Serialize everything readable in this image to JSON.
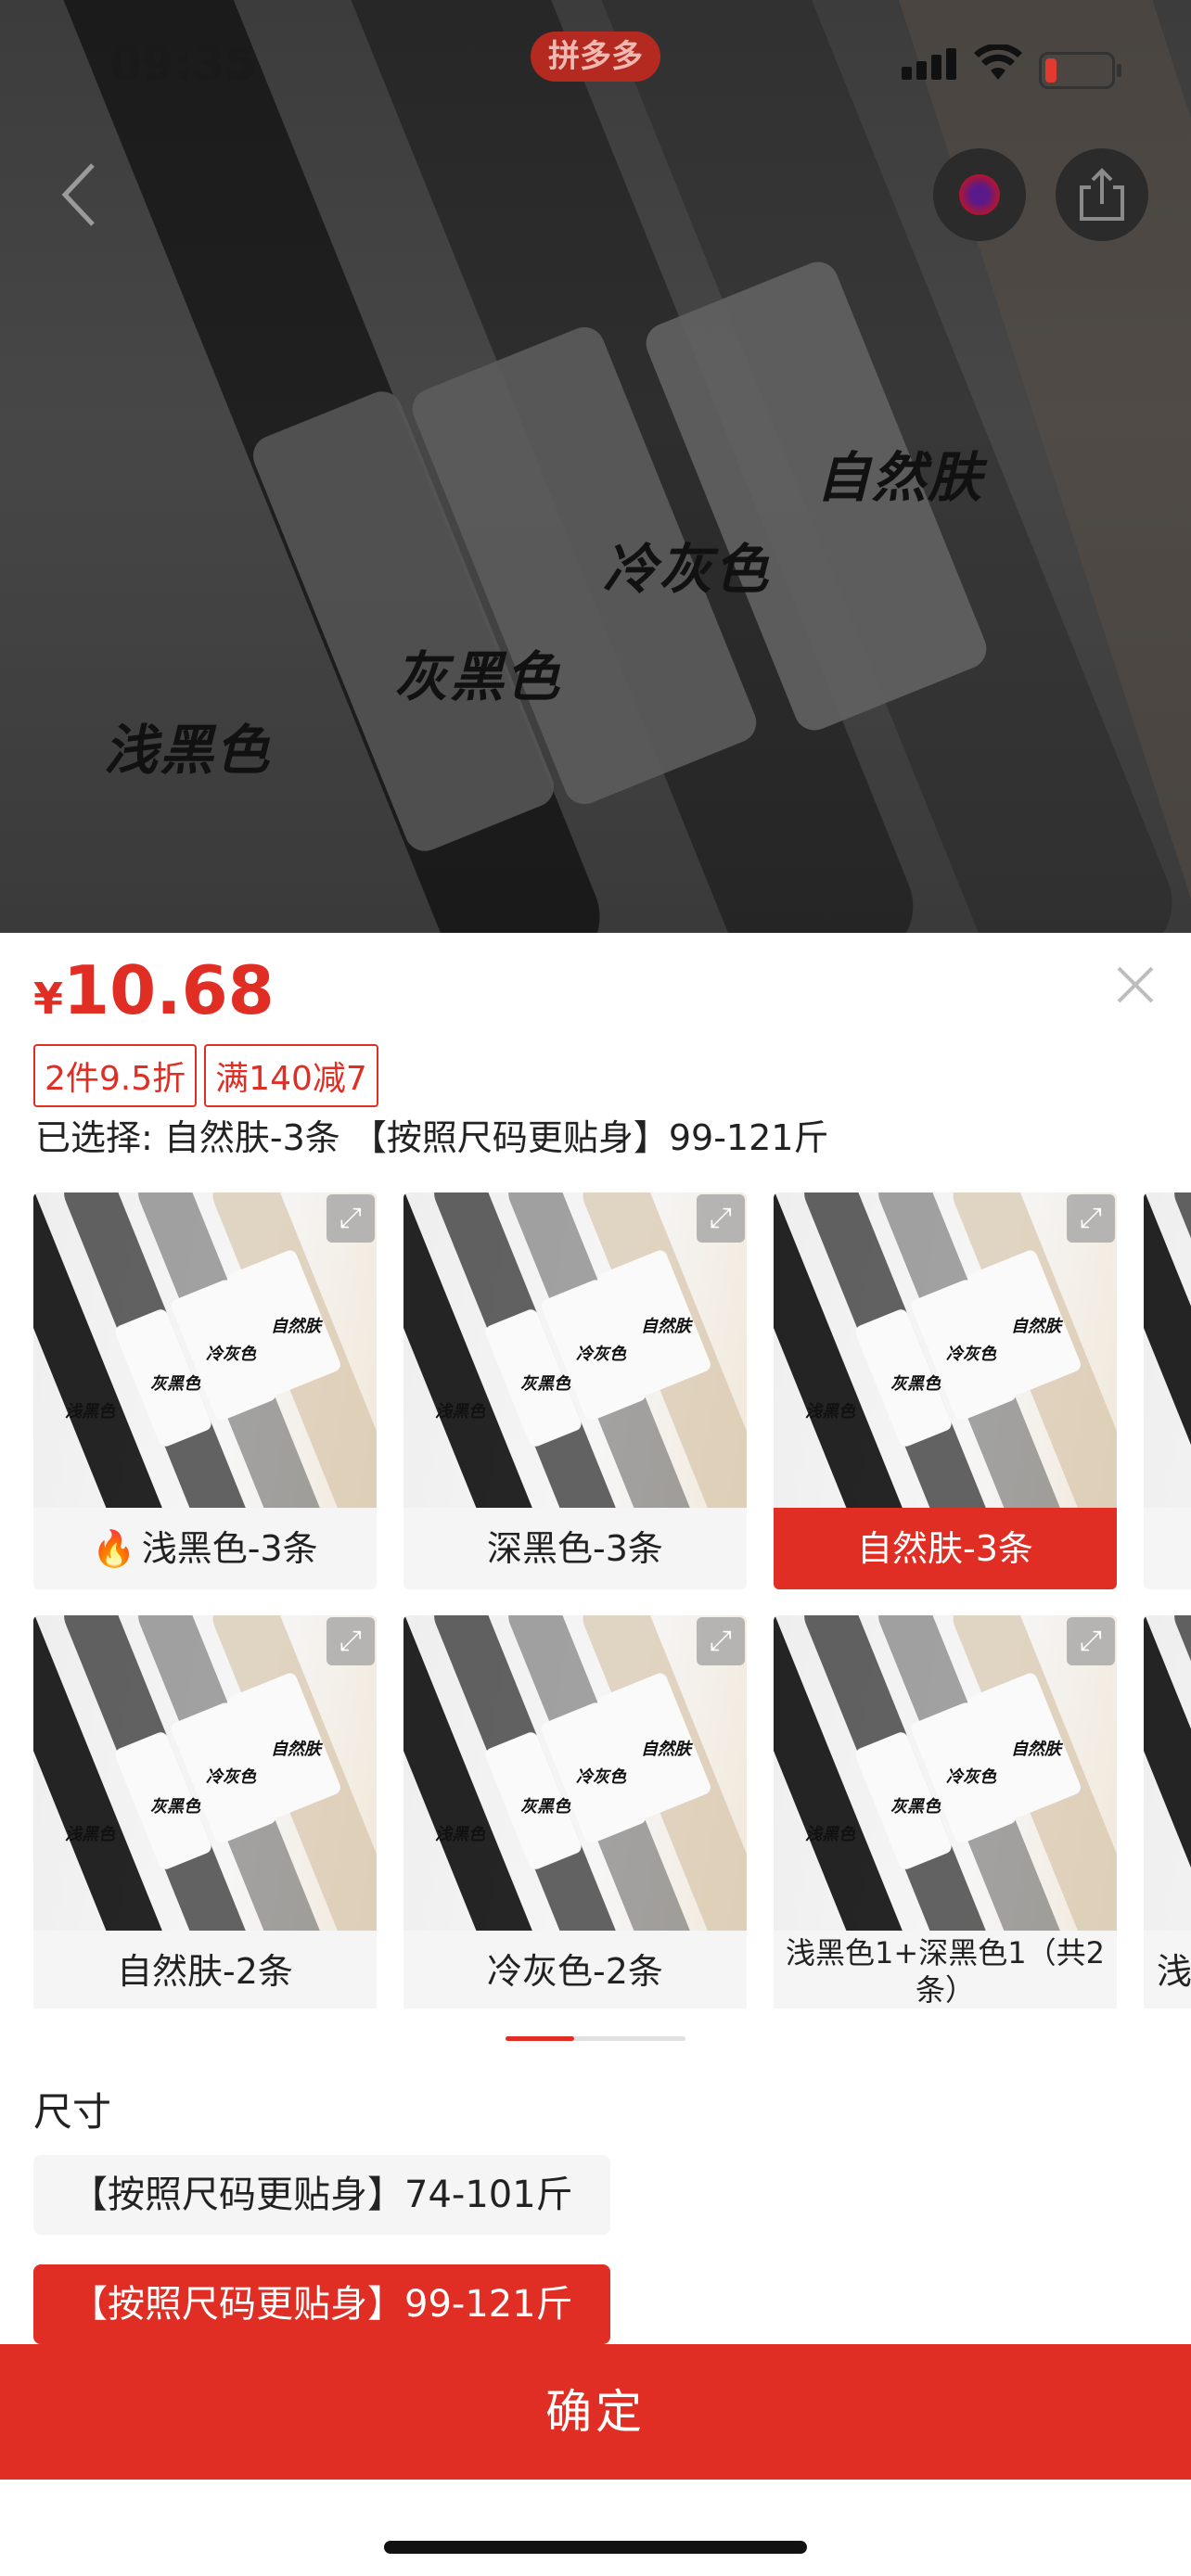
{
  "status": {
    "time": "09:35",
    "app_badge": "拼多多"
  },
  "hero": {
    "labels": [
      "浅黑色",
      "灰黑色",
      "冷灰色",
      "自然肤"
    ]
  },
  "nav": {
    "back_icon": "chevron-left-icon",
    "fav_icon": "heart-icon",
    "share_icon": "share-icon"
  },
  "sheet": {
    "currency": "¥",
    "price": "10.68",
    "promos": [
      "2件9.5折",
      "满140减7"
    ],
    "selected_text": "已选择: 自然肤-3条 【按照尺码更贴身】99-121斤",
    "variants": [
      {
        "label": "浅黑色-3条",
        "hot": true,
        "selected": false
      },
      {
        "label": "深黑色-3条",
        "hot": false,
        "selected": false
      },
      {
        "label": "自然肤-3条",
        "hot": false,
        "selected": true
      },
      {
        "label": "自然肤-2条",
        "hot": false,
        "selected": false
      },
      {
        "label": "冷灰色-2条",
        "hot": false,
        "selected": false
      },
      {
        "label": "浅黑色1+深黑色1（共2条）",
        "hot": false,
        "selected": false
      }
    ],
    "thumb_words": [
      "浅黑色",
      "灰黑色",
      "冷灰色",
      "自然肤"
    ],
    "partial_label": "浅",
    "size_title": "尺寸",
    "sizes": [
      {
        "label": "【按照尺码更贴身】74-101斤",
        "selected": false
      },
      {
        "label": "【按照尺码更贴身】99-121斤",
        "selected": true
      }
    ],
    "confirm_label": "确定",
    "close_icon": "close-icon",
    "accent_color": "#e02e24"
  }
}
